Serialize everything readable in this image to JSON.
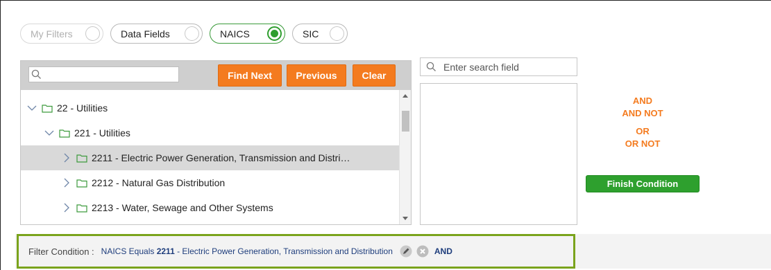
{
  "tabs": [
    {
      "label": "My Filters",
      "state": "disabled"
    },
    {
      "label": "Data Fields",
      "state": "off"
    },
    {
      "label": "NAICS",
      "state": "checked"
    },
    {
      "label": "SIC",
      "state": "off"
    }
  ],
  "tree_toolbar": {
    "search_value": "",
    "find_next": "Find Next",
    "previous": "Previous",
    "clear": "Clear"
  },
  "tree": [
    {
      "label": "22 - Utilities",
      "level": 0,
      "expanded": true,
      "selected": false
    },
    {
      "label": "221 - Utilities",
      "level": 1,
      "expanded": true,
      "selected": false
    },
    {
      "label": "2211 - Electric Power Generation, Transmission and Distri…",
      "level": 2,
      "expanded": false,
      "selected": true
    },
    {
      "label": "2212 - Natural Gas Distribution",
      "level": 2,
      "expanded": false,
      "selected": false
    },
    {
      "label": "2213 - Water, Sewage and Other Systems",
      "level": 2,
      "expanded": false,
      "selected": false
    }
  ],
  "field_search": {
    "placeholder": "Enter search field"
  },
  "operators": [
    "AND",
    "AND NOT",
    "OR",
    "OR NOT"
  ],
  "finish_label": "Finish Condition",
  "condition": {
    "label": "Filter Condition :",
    "prefix": "NAICS Equals ",
    "code": "2211",
    "description": " - Electric Power Generation, Transmission and Distribution",
    "connector": "AND"
  },
  "colors": {
    "accent_orange": "#f47b1f",
    "accent_green": "#2ea02e",
    "folder_green": "#3c9a3c",
    "condition_border": "#7aa31c",
    "condition_text": "#1e3d7c"
  },
  "icons": [
    "search-icon",
    "chevron-down-icon",
    "chevron-right-icon",
    "folder-icon",
    "edit-icon",
    "remove-icon"
  ]
}
